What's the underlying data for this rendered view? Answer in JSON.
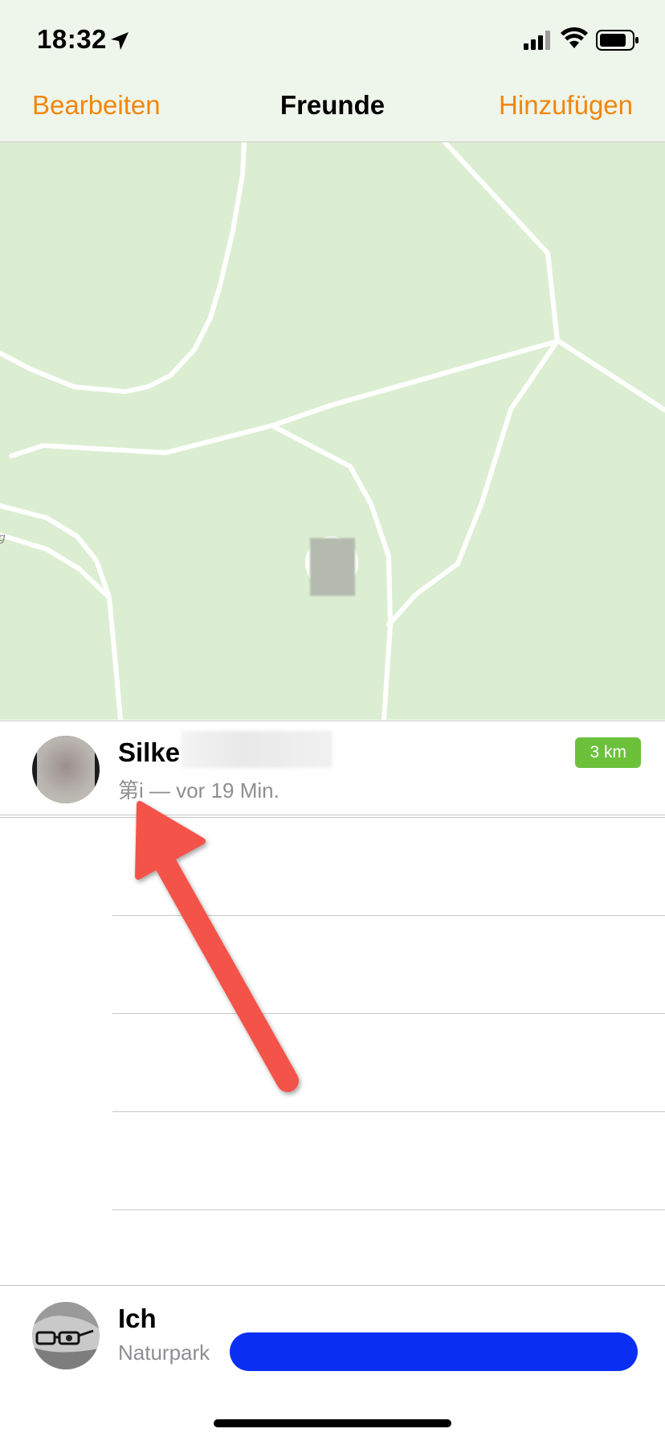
{
  "status_bar": {
    "time": "18:32",
    "icons": [
      "location-arrow-icon",
      "cellular-signal-icon",
      "wifi-icon",
      "battery-icon"
    ]
  },
  "nav": {
    "left": "Bearbeiten",
    "title": "Freunde",
    "right": "Hinzufügen",
    "accent_color": "#f2860d"
  },
  "map": {
    "label_fragment": "g"
  },
  "friends": [
    {
      "name": "Silke",
      "subtitle": "第i — vor 19 Min.",
      "distance": "3 km",
      "distance_color": "#6cc13b"
    }
  ],
  "me": {
    "name": "Ich",
    "location": "Naturpark"
  }
}
